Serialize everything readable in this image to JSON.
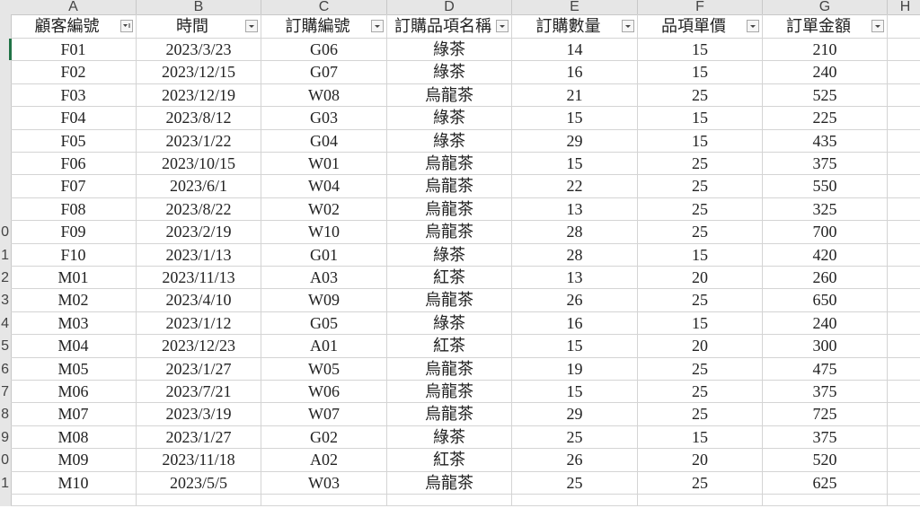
{
  "columns": [
    "A",
    "B",
    "C",
    "D",
    "E",
    "F",
    "G",
    "H"
  ],
  "row_numbers": [
    "",
    "",
    "",
    "",
    "",
    "",
    "",
    "",
    "",
    "0",
    "1",
    "2",
    "3",
    "4",
    "5",
    "6",
    "7",
    "8",
    "9",
    "0",
    "1",
    ""
  ],
  "headers": [
    "顧客編號",
    "時間",
    "訂購編號",
    "訂購品項名稱",
    "訂購數量",
    "品項單價",
    "訂單金額"
  ],
  "filter_icons": [
    "filter-active-icon",
    "dropdown-arrow-icon",
    "dropdown-arrow-icon",
    "dropdown-arrow-icon",
    "dropdown-arrow-icon",
    "dropdown-arrow-icon",
    "dropdown-arrow-icon"
  ],
  "rows": [
    [
      "F01",
      "2023/3/23",
      "G06",
      "綠茶",
      "14",
      "15",
      "210"
    ],
    [
      "F02",
      "2023/12/15",
      "G07",
      "綠茶",
      "16",
      "15",
      "240"
    ],
    [
      "F03",
      "2023/12/19",
      "W08",
      "烏龍茶",
      "21",
      "25",
      "525"
    ],
    [
      "F04",
      "2023/8/12",
      "G03",
      "綠茶",
      "15",
      "15",
      "225"
    ],
    [
      "F05",
      "2023/1/22",
      "G04",
      "綠茶",
      "29",
      "15",
      "435"
    ],
    [
      "F06",
      "2023/10/15",
      "W01",
      "烏龍茶",
      "15",
      "25",
      "375"
    ],
    [
      "F07",
      "2023/6/1",
      "W04",
      "烏龍茶",
      "22",
      "25",
      "550"
    ],
    [
      "F08",
      "2023/8/22",
      "W02",
      "烏龍茶",
      "13",
      "25",
      "325"
    ],
    [
      "F09",
      "2023/2/19",
      "W10",
      "烏龍茶",
      "28",
      "25",
      "700"
    ],
    [
      "F10",
      "2023/1/13",
      "G01",
      "綠茶",
      "28",
      "15",
      "420"
    ],
    [
      "M01",
      "2023/11/13",
      "A03",
      "紅茶",
      "13",
      "20",
      "260"
    ],
    [
      "M02",
      "2023/4/10",
      "W09",
      "烏龍茶",
      "26",
      "25",
      "650"
    ],
    [
      "M03",
      "2023/1/12",
      "G05",
      "綠茶",
      "16",
      "15",
      "240"
    ],
    [
      "M04",
      "2023/12/23",
      "A01",
      "紅茶",
      "15",
      "20",
      "300"
    ],
    [
      "M05",
      "2023/1/27",
      "W05",
      "烏龍茶",
      "19",
      "25",
      "475"
    ],
    [
      "M06",
      "2023/7/21",
      "W06",
      "烏龍茶",
      "15",
      "25",
      "375"
    ],
    [
      "M07",
      "2023/3/19",
      "W07",
      "烏龍茶",
      "29",
      "25",
      "725"
    ],
    [
      "M08",
      "2023/1/27",
      "G02",
      "綠茶",
      "25",
      "15",
      "375"
    ],
    [
      "M09",
      "2023/11/18",
      "A02",
      "紅茶",
      "26",
      "20",
      "520"
    ],
    [
      "M10",
      "2023/5/5",
      "W03",
      "烏龍茶",
      "25",
      "25",
      "625"
    ]
  ],
  "colors": {
    "header_bg": "#e6e6e6",
    "gridline": "#d4d4d4",
    "selection_accent": "#217346",
    "text": "#222222"
  }
}
